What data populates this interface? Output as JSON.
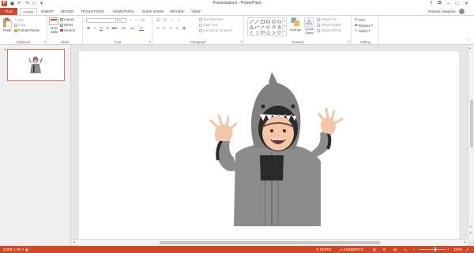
{
  "window": {
    "title": "Presentation1 - PowerPoint",
    "app_logo": "P",
    "qat": [
      {
        "name": "save-icon",
        "glyph": "▣"
      },
      {
        "name": "undo-icon",
        "glyph": "↶"
      },
      {
        "name": "redo-icon",
        "glyph": "↷"
      },
      {
        "name": "start-slideshow-icon",
        "glyph": "▭"
      },
      {
        "name": "customize-qat-icon",
        "glyph": "▾"
      }
    ],
    "controls": {
      "help": "?",
      "ribbon_display": "⧉",
      "minimize": "–",
      "maximize": "□",
      "close": "✕"
    }
  },
  "tabs": [
    {
      "label": "FILE"
    },
    {
      "label": "HOME"
    },
    {
      "label": "INSERT"
    },
    {
      "label": "DESIGN"
    },
    {
      "label": "TRANSITIONS"
    },
    {
      "label": "ANIMATIONS"
    },
    {
      "label": "SLIDE SHOW"
    },
    {
      "label": "REVIEW"
    },
    {
      "label": "VIEW"
    }
  ],
  "active_tab": "HOME",
  "user": {
    "name": "Pamela Vaughan"
  },
  "ribbon": {
    "clipboard": {
      "label": "Clipboard",
      "paste": "Paste",
      "cut": "Cut",
      "copy": "Copy",
      "format_painter": "Format Painter"
    },
    "slides": {
      "label": "Slides",
      "new_slide_line1": "New",
      "new_slide_line2": "Slide",
      "layout": "Layout",
      "reset": "Reset",
      "section": "Section"
    },
    "font": {
      "label": "Font",
      "size": "24",
      "format_buttons": [
        "B",
        "I",
        "U",
        "S",
        "abc",
        "AV",
        "Aa",
        "A"
      ]
    },
    "paragraph": {
      "label": "Paragraph",
      "text_direction": "Text Direction",
      "align_text": "Align Text",
      "convert_smartart": "Convert to SmartArt"
    },
    "drawing": {
      "label": "Drawing",
      "arrange": "Arrange",
      "quick_styles_line1": "Quick",
      "quick_styles_line2": "Styles",
      "shape_fill": "Shape Fill",
      "shape_outline": "Shape Outline",
      "shape_effects": "Shape Effects"
    },
    "editing": {
      "label": "Editing",
      "find": "Find",
      "replace": "Replace",
      "select": "Select"
    }
  },
  "thumbnails": [
    {
      "number": "1"
    }
  ],
  "statusbar": {
    "slide_info": "SLIDE 1 OF 1",
    "notes": "NOTES",
    "comments": "COMMENTS",
    "zoom": "100%",
    "zoom_level_percent": 100
  },
  "colors": {
    "accent": "#d24726",
    "ribbon_bg": "#ffffff",
    "workspace_bg": "#e6e6e6",
    "hoodie_gray": "#8c8c8c",
    "shirt_black": "#2a2a2a"
  }
}
